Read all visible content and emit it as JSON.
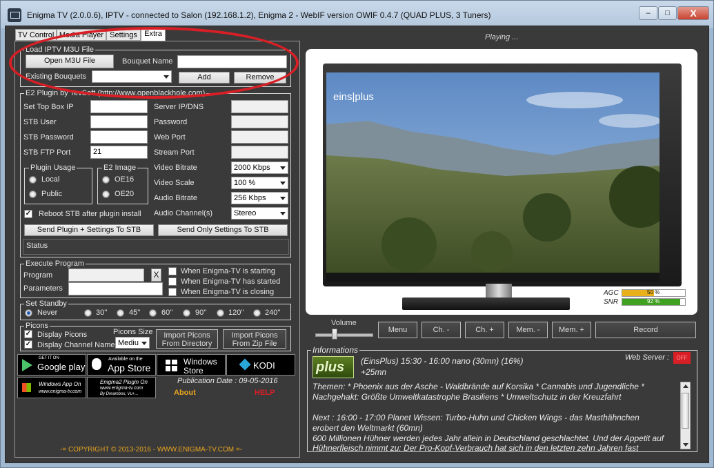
{
  "window": {
    "title": "Enigma TV (2.0.0.6), IPTV - connected to Salon (192.168.1.2), Enigma 2 - WebIF version OWIF 0.4.7 (QUAD PLUS, 3 Tuners)",
    "controls": {
      "minimize": "–",
      "maximize": "□",
      "close": "X"
    }
  },
  "tabs": [
    {
      "label": "TV Control"
    },
    {
      "label": "Media Player"
    },
    {
      "label": "Settings"
    },
    {
      "label": "Extra"
    }
  ],
  "m3u": {
    "group_label": "Load IPTV M3U File",
    "open_button": "Open M3U File",
    "bouquet_name_label": "Bouquet Name",
    "bouquet_name_value": "",
    "existing_label": "Existing Bouquets",
    "existing_value": "",
    "add_button": "Add",
    "remove_button": "Remove"
  },
  "plugin": {
    "group_label": "E2 Plugin by TevSoft (http://www.openblackhole.com)",
    "stb_ip_label": "Set Top Box IP",
    "stb_ip_value": "",
    "stb_user_label": "STB User",
    "stb_user_value": "",
    "stb_password_label": "STB Password",
    "stb_password_value": "",
    "stb_ftp_label": "STB FTP Port",
    "stb_ftp_value": "21",
    "server_label": "Server IP/DNS",
    "password_label": "Password",
    "web_port_label": "Web Port",
    "stream_port_label": "Stream Port",
    "usage_label": "Plugin Usage",
    "usage_local": "Local",
    "usage_public": "Public",
    "image_label": "E2 Image",
    "image_oe16": "OE16",
    "image_oe20": "OE20",
    "video_bitrate_label": "Video Bitrate",
    "video_bitrate_value": "2000 Kbps",
    "video_scale_label": "Video Scale",
    "video_scale_value": "100 %",
    "audio_bitrate_label": "Audio Bitrate",
    "audio_bitrate_value": "256 Kbps",
    "audio_channels_label": "Audio Channel(s)",
    "audio_channels_value": "Stereo",
    "reboot_label": "Reboot STB after plugin install",
    "send_all_button": "Send Plugin + Settings To STB",
    "send_settings_button": "Send Only Settings To STB",
    "status_label": "Status"
  },
  "execute": {
    "group_label": "Execute Program",
    "program_label": "Program",
    "parameters_label": "Parameters",
    "clear_button": "X",
    "opt_starting": "When Enigma-TV is starting",
    "opt_started": "When Enigma-TV has started",
    "opt_closing": "When Enigma-TV is closing"
  },
  "standby": {
    "group_label": "Set Standby",
    "options": [
      "Never",
      "30''",
      "45''",
      "60''",
      "90''",
      "120''",
      "240''"
    ]
  },
  "picons": {
    "group_label": "Picons",
    "display_picons": "Display Picons",
    "display_channel_name": "Display Channel Name",
    "size_label": "Picons Size",
    "size_value": "Mediu",
    "import_dir_button_l1": "Import Picons",
    "import_dir_button_l2": "From Directory",
    "import_zip_button_l1": "Import Picons",
    "import_zip_button_l2": "From Zip File"
  },
  "stores": {
    "google_small": "GET IT ON",
    "google_big": "Google play",
    "apple_small": "Available on the",
    "apple_big": "App Store",
    "windows_big1": "Windows",
    "windows_big2": "Store",
    "kodi": "KODI",
    "winapp_l1": "Windows App On",
    "winapp_l2": "www.enigma-tv.com",
    "e2plugin_l1": "Enigma2 Plugin On",
    "e2plugin_l2": "www.enigma-tv.com",
    "e2plugin_l3": "By Dreambox, Vu+..."
  },
  "footer": {
    "publication": "Publication Date : 09-05-2016",
    "about": "About",
    "help": "HELP",
    "copyright": "-= COPYRIGHT © 2013-2016 - WWW.ENIGMA-TV.COM =-"
  },
  "player": {
    "status": "Playing ...",
    "channel_logo": "eins|plus",
    "agc_label": "AGC",
    "agc_value": "50 %",
    "agc_level": 0.5,
    "snr_label": "SNR",
    "snr_value": "92 %",
    "snr_level": 0.92,
    "volume_label": "Volume",
    "volume_level": 0.3,
    "buttons": {
      "menu": "Menu",
      "ch_minus": "Ch. -",
      "ch_plus": "Ch. +",
      "mem_minus": "Mem. -",
      "mem_plus": "Mem. +",
      "record": "Record"
    }
  },
  "info": {
    "group_label": "Informations",
    "web_server_label": "Web Server :",
    "web_server_value": "OFF",
    "logo": "plus",
    "line1": "(EinsPlus)    15:30 - 16:00    nano    (30mn)    (16%)",
    "line2": "+25mn",
    "themen1": "Themen: * Phoenix aus der Asche - Waldbrände auf Korsika * Cannabis und Jugendliche *",
    "themen2": "Nachgehakt: Größte Umweltkatastrophe Brasiliens * Umweltschutz in der Kreuzfahrt",
    "next1": "Next :      16:00 - 17:00    Planet Wissen: Turbo-Huhn und Chicken Wings - das Masthähnchen",
    "next2": "erobert den Weltmarkt    (60mn)",
    "next3": "600 Millionen Hühner werden jedes Jahr allein in Deutschland geschlachtet. Und der Appetit auf",
    "next4": "Hühnerfleisch nimmt zu: Der Pro-Kopf-Verbrauch hat sich in den letzten zehn Jahren fast"
  }
}
